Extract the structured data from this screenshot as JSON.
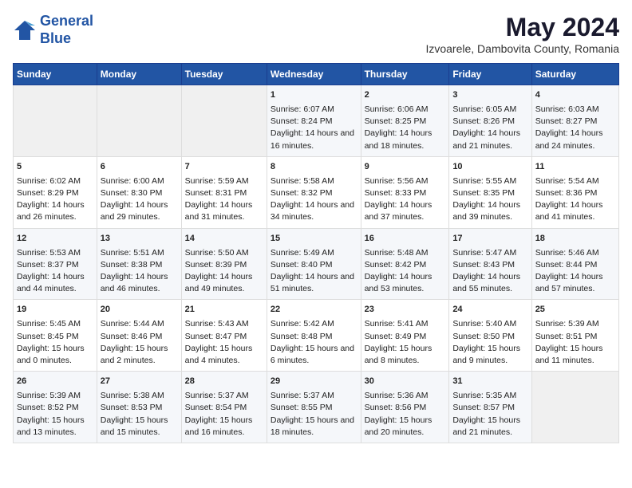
{
  "header": {
    "logo_line1": "General",
    "logo_line2": "Blue",
    "month_title": "May 2024",
    "location": "Izvoarele, Dambovita County, Romania"
  },
  "weekdays": [
    "Sunday",
    "Monday",
    "Tuesday",
    "Wednesday",
    "Thursday",
    "Friday",
    "Saturday"
  ],
  "weeks": [
    [
      {
        "day": "",
        "empty": true
      },
      {
        "day": "",
        "empty": true
      },
      {
        "day": "",
        "empty": true
      },
      {
        "day": "1",
        "sunrise": "6:07 AM",
        "sunset": "8:24 PM",
        "daylight": "14 hours and 16 minutes."
      },
      {
        "day": "2",
        "sunrise": "6:06 AM",
        "sunset": "8:25 PM",
        "daylight": "14 hours and 18 minutes."
      },
      {
        "day": "3",
        "sunrise": "6:05 AM",
        "sunset": "8:26 PM",
        "daylight": "14 hours and 21 minutes."
      },
      {
        "day": "4",
        "sunrise": "6:03 AM",
        "sunset": "8:27 PM",
        "daylight": "14 hours and 24 minutes."
      }
    ],
    [
      {
        "day": "5",
        "sunrise": "6:02 AM",
        "sunset": "8:29 PM",
        "daylight": "14 hours and 26 minutes."
      },
      {
        "day": "6",
        "sunrise": "6:00 AM",
        "sunset": "8:30 PM",
        "daylight": "14 hours and 29 minutes."
      },
      {
        "day": "7",
        "sunrise": "5:59 AM",
        "sunset": "8:31 PM",
        "daylight": "14 hours and 31 minutes."
      },
      {
        "day": "8",
        "sunrise": "5:58 AM",
        "sunset": "8:32 PM",
        "daylight": "14 hours and 34 minutes."
      },
      {
        "day": "9",
        "sunrise": "5:56 AM",
        "sunset": "8:33 PM",
        "daylight": "14 hours and 37 minutes."
      },
      {
        "day": "10",
        "sunrise": "5:55 AM",
        "sunset": "8:35 PM",
        "daylight": "14 hours and 39 minutes."
      },
      {
        "day": "11",
        "sunrise": "5:54 AM",
        "sunset": "8:36 PM",
        "daylight": "14 hours and 41 minutes."
      }
    ],
    [
      {
        "day": "12",
        "sunrise": "5:53 AM",
        "sunset": "8:37 PM",
        "daylight": "14 hours and 44 minutes."
      },
      {
        "day": "13",
        "sunrise": "5:51 AM",
        "sunset": "8:38 PM",
        "daylight": "14 hours and 46 minutes."
      },
      {
        "day": "14",
        "sunrise": "5:50 AM",
        "sunset": "8:39 PM",
        "daylight": "14 hours and 49 minutes."
      },
      {
        "day": "15",
        "sunrise": "5:49 AM",
        "sunset": "8:40 PM",
        "daylight": "14 hours and 51 minutes."
      },
      {
        "day": "16",
        "sunrise": "5:48 AM",
        "sunset": "8:42 PM",
        "daylight": "14 hours and 53 minutes."
      },
      {
        "day": "17",
        "sunrise": "5:47 AM",
        "sunset": "8:43 PM",
        "daylight": "14 hours and 55 minutes."
      },
      {
        "day": "18",
        "sunrise": "5:46 AM",
        "sunset": "8:44 PM",
        "daylight": "14 hours and 57 minutes."
      }
    ],
    [
      {
        "day": "19",
        "sunrise": "5:45 AM",
        "sunset": "8:45 PM",
        "daylight": "15 hours and 0 minutes."
      },
      {
        "day": "20",
        "sunrise": "5:44 AM",
        "sunset": "8:46 PM",
        "daylight": "15 hours and 2 minutes."
      },
      {
        "day": "21",
        "sunrise": "5:43 AM",
        "sunset": "8:47 PM",
        "daylight": "15 hours and 4 minutes."
      },
      {
        "day": "22",
        "sunrise": "5:42 AM",
        "sunset": "8:48 PM",
        "daylight": "15 hours and 6 minutes."
      },
      {
        "day": "23",
        "sunrise": "5:41 AM",
        "sunset": "8:49 PM",
        "daylight": "15 hours and 8 minutes."
      },
      {
        "day": "24",
        "sunrise": "5:40 AM",
        "sunset": "8:50 PM",
        "daylight": "15 hours and 9 minutes."
      },
      {
        "day": "25",
        "sunrise": "5:39 AM",
        "sunset": "8:51 PM",
        "daylight": "15 hours and 11 minutes."
      }
    ],
    [
      {
        "day": "26",
        "sunrise": "5:39 AM",
        "sunset": "8:52 PM",
        "daylight": "15 hours and 13 minutes."
      },
      {
        "day": "27",
        "sunrise": "5:38 AM",
        "sunset": "8:53 PM",
        "daylight": "15 hours and 15 minutes."
      },
      {
        "day": "28",
        "sunrise": "5:37 AM",
        "sunset": "8:54 PM",
        "daylight": "15 hours and 16 minutes."
      },
      {
        "day": "29",
        "sunrise": "5:37 AM",
        "sunset": "8:55 PM",
        "daylight": "15 hours and 18 minutes."
      },
      {
        "day": "30",
        "sunrise": "5:36 AM",
        "sunset": "8:56 PM",
        "daylight": "15 hours and 20 minutes."
      },
      {
        "day": "31",
        "sunrise": "5:35 AM",
        "sunset": "8:57 PM",
        "daylight": "15 hours and 21 minutes."
      },
      {
        "day": "",
        "empty": true
      }
    ]
  ],
  "labels": {
    "sunrise": "Sunrise:",
    "sunset": "Sunset:",
    "daylight": "Daylight hours"
  }
}
